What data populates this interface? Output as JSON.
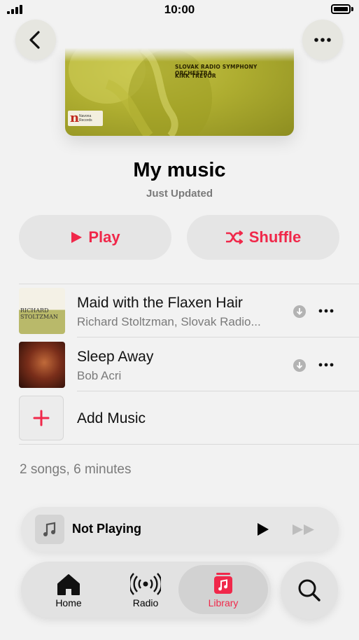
{
  "status_bar": {
    "time": "10:00"
  },
  "cover": {
    "orchestra": "SLOVAK RADIO SYMPHONY ORCHESTRA",
    "conductor": "KIRK TREVOR",
    "label_initial": "n",
    "label_name": "Navona Records"
  },
  "header": {
    "back_icon": "chevron-left-icon",
    "more_icon": "ellipsis-icon"
  },
  "playlist": {
    "title": "My music",
    "subtitle": "Just Updated"
  },
  "actions": {
    "play_label": "Play",
    "shuffle_label": "Shuffle"
  },
  "songs": [
    {
      "title": "Maid with the Flaxen Hair",
      "artist": "Richard Stoltzman, Slovak Radio...",
      "art_text": "RICHARD STOLTZMAN"
    },
    {
      "title": "Sleep Away",
      "artist": "Bob Acri"
    }
  ],
  "add_music": {
    "label": "Add Music"
  },
  "summary": "2 songs, 6 minutes",
  "mini_player": {
    "status": "Not Playing"
  },
  "tabs": [
    {
      "label": "Home",
      "icon": "home-icon"
    },
    {
      "label": "Radio",
      "icon": "radio-icon"
    },
    {
      "label": "Library",
      "icon": "library-icon",
      "selected": true
    }
  ],
  "colors": {
    "accent": "#f0284a",
    "background": "#f2f2f2"
  }
}
